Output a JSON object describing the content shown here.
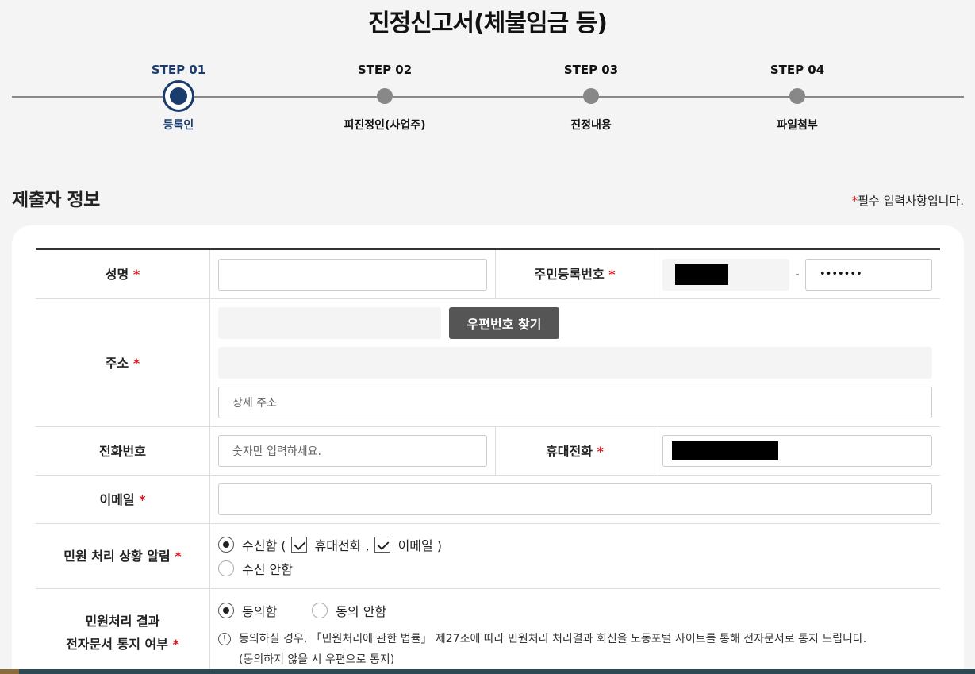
{
  "page_title": "진정신고서(체불임금 등)",
  "steps": [
    {
      "no": "STEP 01",
      "name": "등록인",
      "active": true
    },
    {
      "no": "STEP 02",
      "name": "피진정인(사업주)",
      "active": false
    },
    {
      "no": "STEP 03",
      "name": "진정내용",
      "active": false
    },
    {
      "no": "STEP 04",
      "name": "파일첨부",
      "active": false
    }
  ],
  "section_title": "제출자 정보",
  "required_note": {
    "star": "*",
    "text": "필수 입력사항입니다."
  },
  "form": {
    "required_mark": "*",
    "name": {
      "label": "성명",
      "value": ""
    },
    "resident_no": {
      "label": "주민등록번호",
      "separator": "-",
      "back_value": "•••••••"
    },
    "address": {
      "label": "주소",
      "zip_button": "우편번호 찾기",
      "detail_placeholder": "상세 주소"
    },
    "phone": {
      "label": "전화번호",
      "placeholder": "숫자만 입력하세요."
    },
    "mobile": {
      "label": "휴대전화"
    },
    "email": {
      "label": "이메일",
      "value": ""
    },
    "notify": {
      "label": "민원 처리 상황 알림",
      "receive": "수신함 (",
      "mobile_opt": "휴대전화 ,",
      "email_opt": "이메일 )",
      "no_receive": "수신 안함"
    },
    "edoc": {
      "label_line1": "민원처리 결과",
      "label_line2": "전자문서 통지 여부",
      "agree": "동의함",
      "disagree": "동의 안함",
      "notice_icon": "!",
      "notice_line1": "동의하실 경우, 「민원처리에 관한 법률」 제27조에 따라 민원처리 처리결과 회신을 노동포털 사이트를 통해 전자문서로 통지 드립니다.",
      "notice_line2": "(동의하지 않을 시 우편으로 통지)"
    }
  },
  "colors": {
    "accent": "#1b3d6d",
    "required": "#d71920",
    "button": "#555555"
  }
}
